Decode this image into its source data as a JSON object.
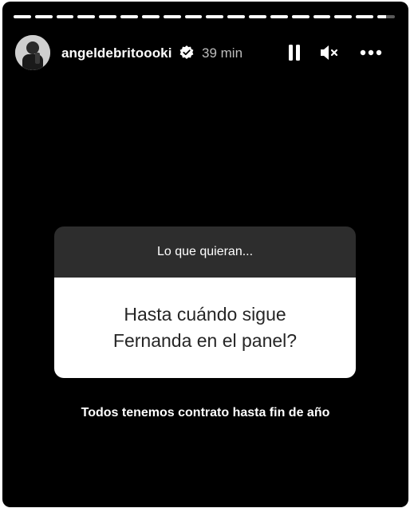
{
  "header": {
    "username": "angeldebritoooki",
    "time_ago": "39 min",
    "verified_icon": "verified-badge-icon",
    "pause_icon": "pause-icon",
    "mute_icon": "speaker-muted-icon",
    "more_icon": "more-options-icon"
  },
  "question_card": {
    "prompt": "Lo que quieran...",
    "question": "Hasta cuándo sigue Fernanda en el panel?"
  },
  "reply": "Todos tenemos contrato hasta fin de año",
  "colors": {
    "background": "#000000",
    "card_header": "#2d2d2d",
    "card_body": "#ffffff",
    "text_light": "#ffffff",
    "text_dark": "#262626"
  }
}
